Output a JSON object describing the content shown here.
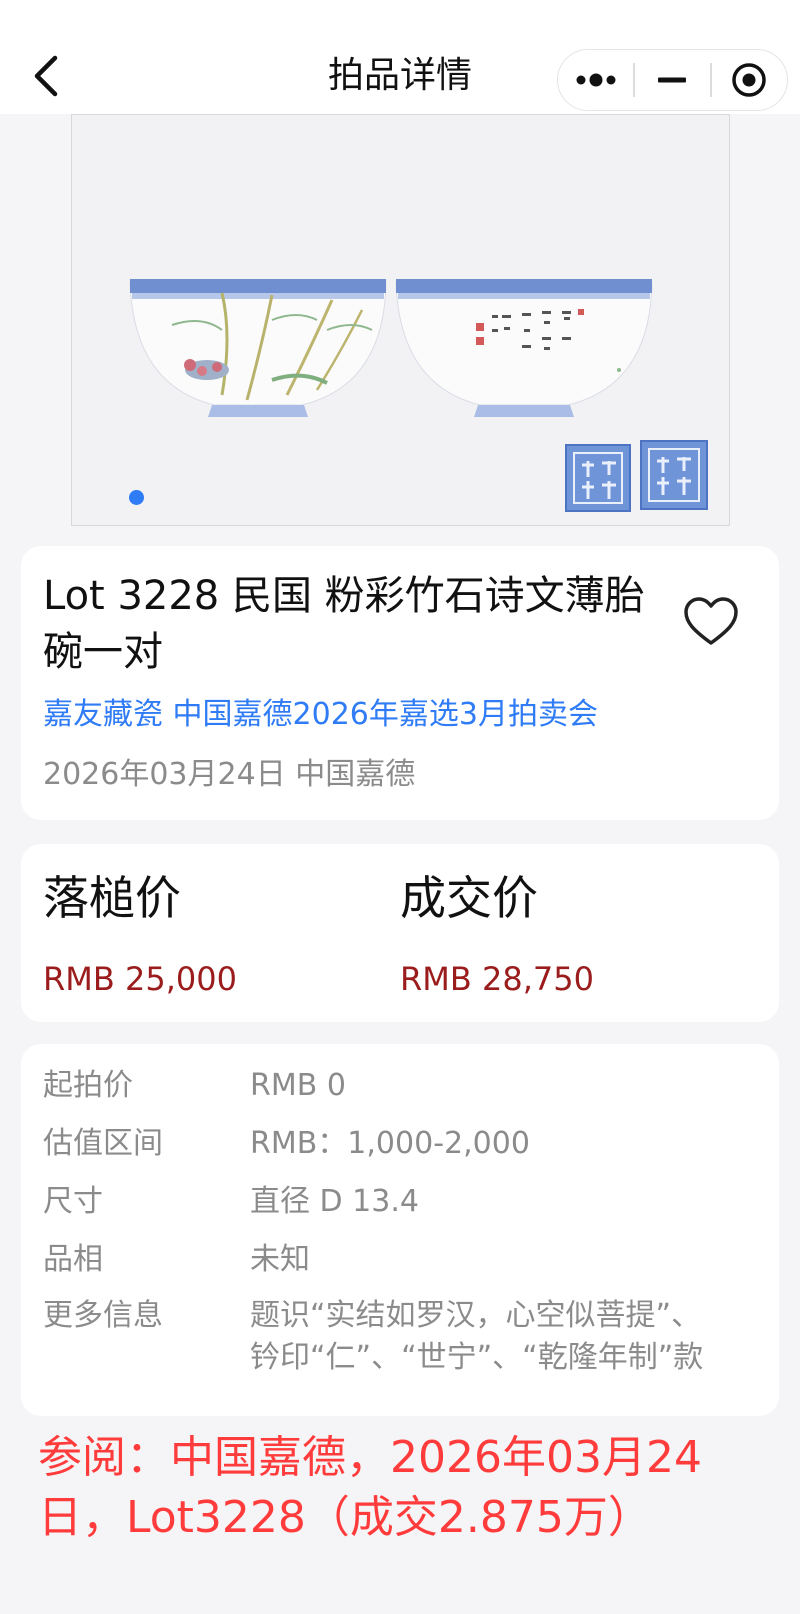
{
  "header": {
    "title": "拍品详情",
    "back_icon": "chevron-left-icon",
    "capsule_icons": [
      "more-dots-icon",
      "minimize-icon",
      "target-icon"
    ]
  },
  "carousel": {
    "image_alt": "粉彩竹石诗文薄胎碗一对",
    "dot_count": 1,
    "active_index": 0
  },
  "lot": {
    "title": "Lot 3228 民国 粉彩竹石诗文薄胎碗一对",
    "auction": "嘉友藏瓷 中国嘉德2026年嘉选3月拍卖会",
    "date_location": "2026年03月24日 中国嘉德",
    "favorite_icon": "heart-outline-icon"
  },
  "prices": {
    "hammer_label": "落槌价",
    "hammer_value": "RMB 25,000",
    "final_label": "成交价",
    "final_value": "RMB 28,750"
  },
  "details": [
    {
      "key": "起拍价",
      "value": "RMB 0"
    },
    {
      "key": "估值区间",
      "value": "RMB：1,000-2,000"
    },
    {
      "key": "尺寸",
      "value": "直径  D 13.4"
    },
    {
      "key": "品相",
      "value": "未知"
    },
    {
      "key": "更多信息",
      "value": "题识“实结如罗汉，心空似菩提”、",
      "value2": "钤印“仁”、“世宁”、“乾隆年制”款"
    }
  ],
  "reference": {
    "line1": "参阅：中国嘉德，2026年03月24",
    "line2": "日，Lot3228（成交2.875万）"
  },
  "colors": {
    "accent_blue": "#2f7cf6",
    "price_red": "#9b1c1c",
    "reference_red": "#ff3b3b",
    "muted_gray": "#8b8b8b",
    "background": "#f5f5f7"
  }
}
